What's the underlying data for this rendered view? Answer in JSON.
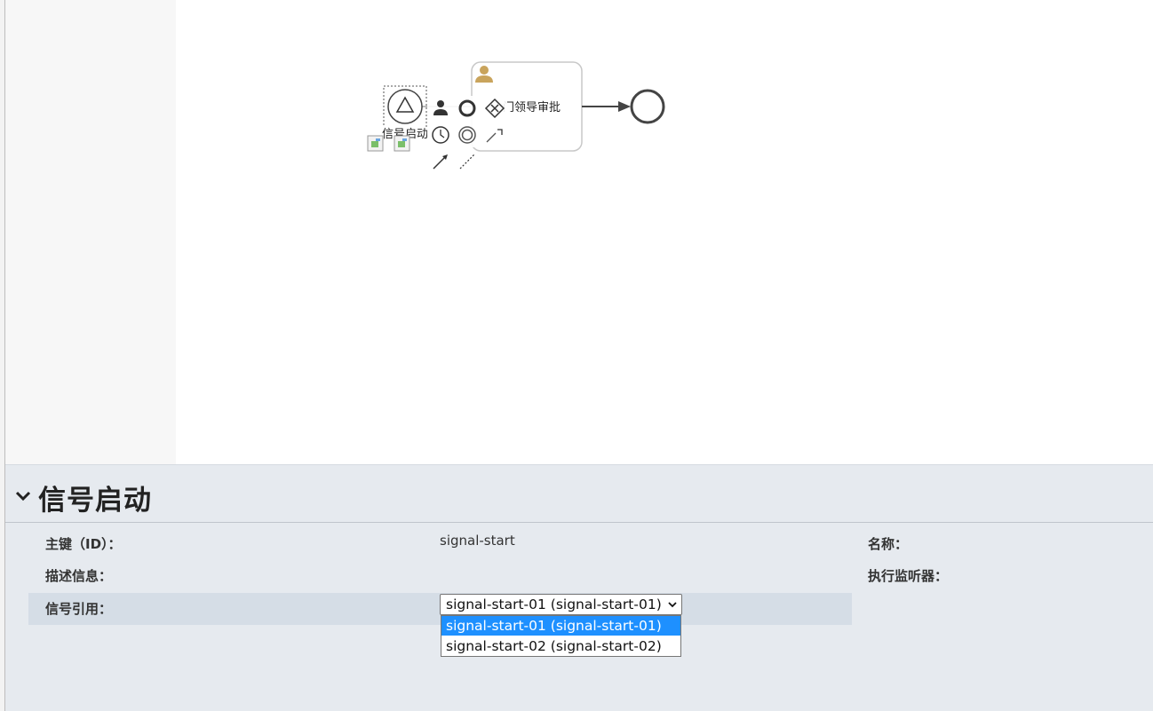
{
  "diagram": {
    "start_event_label": "信号启动",
    "user_task_label": "部门领导审批",
    "user_task_label_visible": "门领导审批",
    "start_event_label_visible": "信号启动"
  },
  "properties": {
    "title": "信号启动",
    "fields": {
      "id_label": "主键（ID）：",
      "id_value": "signal-start",
      "name_label": "名称：",
      "description_label": "描述信息：",
      "listener_label": "执行监听器：",
      "signal_ref_label": "信号引用："
    },
    "signal_select": {
      "selected": "signal-start-01 (signal-start-01)",
      "options": [
        "signal-start-01 (signal-start-01)",
        "signal-start-02 (signal-start-02)"
      ],
      "highlight_color": "#1e90ff"
    }
  },
  "icons": [
    "triangle-signal-icon",
    "user-icon",
    "end-event-icon",
    "intermediate-event-icon",
    "gateway-icon",
    "append-task-icon",
    "connect-arrow-icon",
    "association-icon",
    "broken-image-icon",
    "chevron-down-icon",
    "wrench-icon",
    "timer-icon"
  ]
}
